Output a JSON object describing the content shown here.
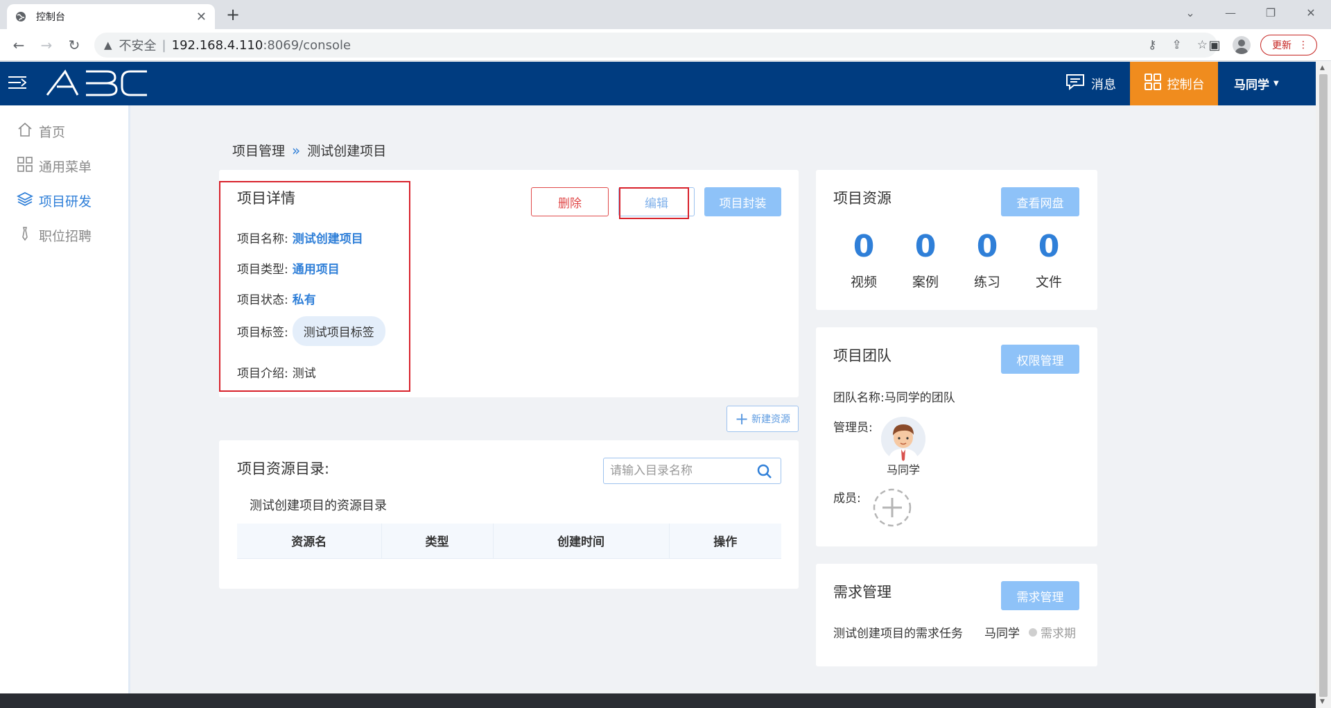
{
  "browser": {
    "tab_title": "控制台",
    "url_insecure_label": "不安全",
    "url_separator": "|",
    "url_host": "192.168.4.110",
    "url_path": ":8069/console",
    "update_label": "更新"
  },
  "header": {
    "logo_text": "ABC",
    "messages_label": "消息",
    "console_label": "控制台",
    "user_label": "马同学"
  },
  "sidebar": {
    "items": [
      {
        "label": "首页",
        "icon": "home-icon",
        "active": false
      },
      {
        "label": "通用菜单",
        "icon": "grid-icon",
        "active": false
      },
      {
        "label": "项目研发",
        "icon": "layers-icon",
        "active": true
      },
      {
        "label": "职位招聘",
        "icon": "tie-icon",
        "active": false
      }
    ]
  },
  "breadcrumb": {
    "parent": "项目管理",
    "current": "测试创建项目"
  },
  "project_detail": {
    "title": "项目详情",
    "delete_label": "删除",
    "edit_label": "编辑",
    "seal_label": "项目封装",
    "name_label": "项目名称:",
    "name_value": "测试创建项目",
    "type_label": "项目类型:",
    "type_value": "通用项目",
    "status_label": "项目状态:",
    "status_value": "私有",
    "tag_label": "项目标签:",
    "tag_value": "测试项目标签",
    "intro_label": "项目介绍:",
    "intro_value": "测试"
  },
  "resource_catalog": {
    "new_resource_label": "新建资源",
    "title": "项目资源目录:",
    "search_placeholder": "请输入目录名称",
    "catalog_name": "测试创建项目的资源目录",
    "columns": [
      "资源名",
      "类型",
      "创建时间",
      "操作"
    ]
  },
  "project_resources": {
    "title": "项目资源",
    "button_label": "查看网盘",
    "stats": [
      {
        "value": "0",
        "label": "视频"
      },
      {
        "value": "0",
        "label": "案例"
      },
      {
        "value": "0",
        "label": "练习"
      },
      {
        "value": "0",
        "label": "文件"
      }
    ]
  },
  "project_team": {
    "title": "项目团队",
    "button_label": "权限管理",
    "team_name_label": "团队名称:",
    "team_name_value": "马同学的团队",
    "admin_label": "管理员:",
    "admin_name": "马同学",
    "members_label": "成员:"
  },
  "requirements": {
    "title": "需求管理",
    "button_label": "需求管理",
    "task_name": "测试创建项目的需求任务",
    "task_owner": "马同学",
    "task_status": "需求期"
  },
  "colors": {
    "header_bg": "#003c80",
    "console_accent": "#f08c1e",
    "primary_blue": "#2f7fd8",
    "danger_red": "#e04848",
    "highlight_box": "#d8202a"
  }
}
